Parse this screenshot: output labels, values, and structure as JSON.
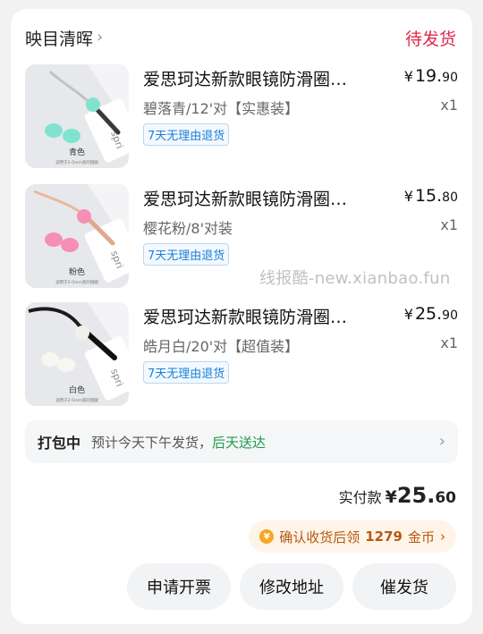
{
  "shop": {
    "name": "映目清晖",
    "status": "待发货"
  },
  "items": [
    {
      "title": "爱思珂达新款眼镜防滑圈…",
      "price_currency": "¥",
      "price_int": "19.",
      "price_dec": "90",
      "spec": "碧落青/12'对【实惠装】",
      "qty": "x1",
      "tag": "7天无理由退货",
      "thumb_caption": "青色",
      "thumb_note": "适用于2-5mm宽的镜腿",
      "thumb_color": "#7fe3cf"
    },
    {
      "title": "爱思珂达新款眼镜防滑圈…",
      "price_currency": "¥",
      "price_int": "15.",
      "price_dec": "80",
      "spec": "樱花粉/8'对装",
      "qty": "x1",
      "tag": "7天无理由退货",
      "thumb_caption": "粉色",
      "thumb_note": "适用于2-5mm宽的镜腿",
      "thumb_color": "#f58fb3"
    },
    {
      "title": "爱思珂达新款眼镜防滑圈…",
      "price_currency": "¥",
      "price_int": "25.",
      "price_dec": "90",
      "spec": "皓月白/20'对【超值装】",
      "qty": "x1",
      "tag": "7天无理由退货",
      "thumb_caption": "白色",
      "thumb_note": "适用于2-5mm宽的镜腿",
      "thumb_color": "#f7f7f2"
    }
  ],
  "thumb_book_text": "spri",
  "shipping": {
    "status": "打包中",
    "text": "预计今天下午发货，",
    "highlight": "后天送达"
  },
  "total": {
    "label": "实付款",
    "currency": "¥",
    "int": "25.",
    "dec": "60"
  },
  "reward": {
    "prefix": "确认收货后领",
    "amount": "1279",
    "suffix": "金币"
  },
  "actions": {
    "invoice": "申请开票",
    "edit_address": "修改地址",
    "urge_ship": "催发货"
  },
  "watermark": "线报酷-new.xianbao.fun",
  "colors": {
    "status_red": "#e0284b",
    "tag_blue": "#1a7fd6",
    "green": "#1c9a4a",
    "reward_brown": "#b45a12"
  }
}
